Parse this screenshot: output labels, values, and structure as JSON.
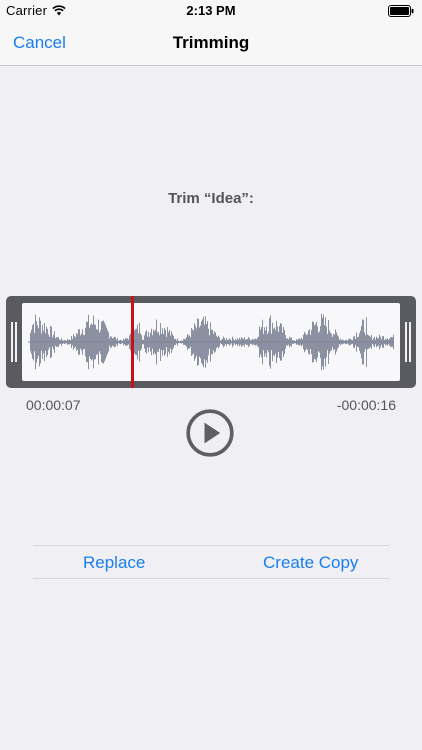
{
  "status_bar": {
    "carrier": "Carrier",
    "time": "2:13 PM",
    "icons": [
      "wifi-icon",
      "battery-icon"
    ]
  },
  "nav": {
    "cancel_label": "Cancel",
    "title": "Trimming"
  },
  "trim": {
    "prompt": "Trim “Idea”:",
    "elapsed": "00:00:07",
    "remaining": "-00:00:16"
  },
  "player": {
    "icon": "play-icon"
  },
  "actions": {
    "replace_label": "Replace",
    "create_copy_label": "Create Copy"
  },
  "colors": {
    "accent": "#1a7ef0",
    "playhead": "#c8101c",
    "waveform": "#7f8597",
    "trimmer_frame": "#5a5b60"
  }
}
